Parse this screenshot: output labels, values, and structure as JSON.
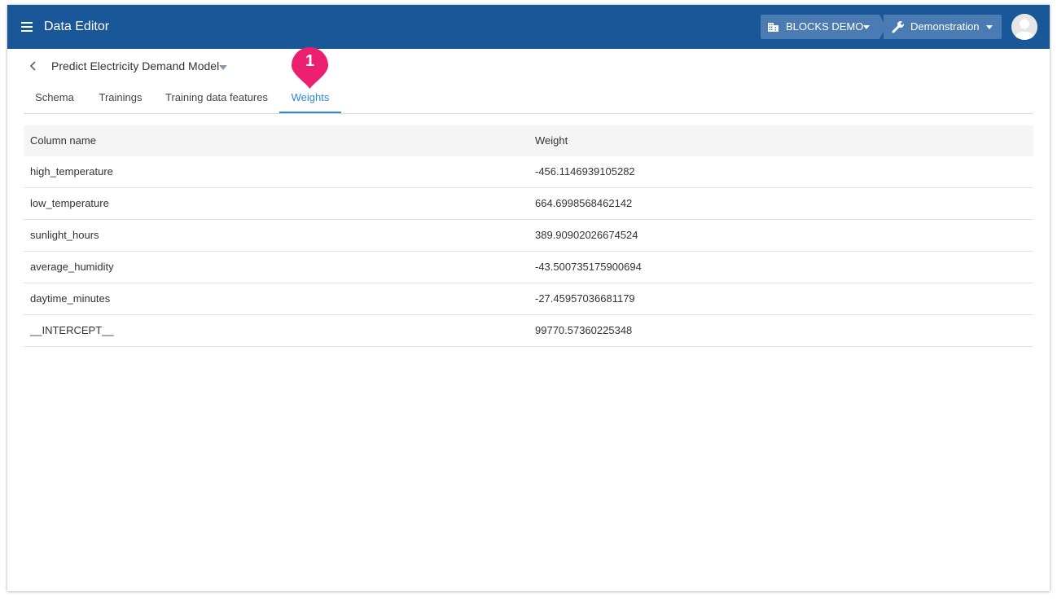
{
  "app": {
    "title": "Data Editor",
    "organization": "BLOCKS DEMO",
    "project": "Demonstration",
    "colors": {
      "header_bg": "#1a5799",
      "selector_bg": "#4a7bb2",
      "active_tab": "#2a8ad6",
      "marker": "#ec1f6e"
    }
  },
  "model": {
    "name": "Predict Electricity Demand Model"
  },
  "tabs": [
    {
      "label": "Schema"
    },
    {
      "label": "Trainings"
    },
    {
      "label": "Training data features"
    },
    {
      "label": "Weights",
      "active": true
    }
  ],
  "annotation": {
    "number": "1"
  },
  "table": {
    "headers": {
      "column_name": "Column name",
      "weight": "Weight"
    },
    "rows": [
      {
        "name": "high_temperature",
        "weight": "-456.1146939105282"
      },
      {
        "name": "low_temperature",
        "weight": "664.6998568462142"
      },
      {
        "name": "sunlight_hours",
        "weight": "389.90902026674524"
      },
      {
        "name": "average_humidity",
        "weight": "-43.500735175900694"
      },
      {
        "name": "daytime_minutes",
        "weight": "-27.45957036681179"
      },
      {
        "name": "__INTERCEPT__",
        "weight": "99770.57360225348"
      }
    ]
  },
  "icons": [
    "menu-icon",
    "building-icon",
    "wrench-icon",
    "avatar-icon",
    "back-arrow-icon",
    "dropdown-caret-icon"
  ]
}
